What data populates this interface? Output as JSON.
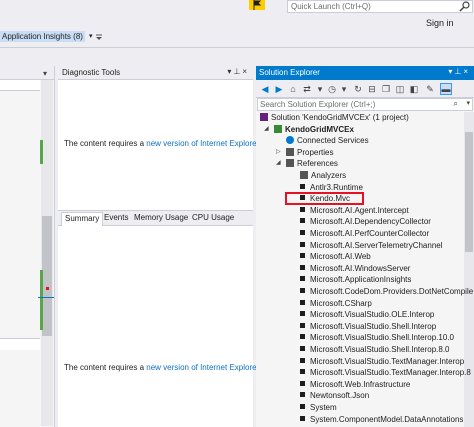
{
  "topbar": {
    "quick_launch_placeholder": "Quick Launch (Ctrl+Q)",
    "sign_in": "Sign in",
    "application_insights": "Application Insights (8)",
    "dropdown_glyph": "▾"
  },
  "diagnostic_tools": {
    "title": "Diagnostic Tools",
    "message_prefix": "The content requires a ",
    "message_link": "new version of Internet Explorer",
    "message_suffix": ".",
    "tabs": [
      "Summary",
      "Events",
      "Memory Usage",
      "CPU Usage"
    ],
    "selected_tab": "Summary"
  },
  "solution_explorer": {
    "title": "Solution Explorer",
    "search_placeholder": "Search Solution Explorer (Ctrl+;)",
    "tree": [
      {
        "label": "Solution 'KendoGridMVCEx' (1 project)",
        "level": 0,
        "icon": "solution-icon"
      },
      {
        "label": "KendoGridMVCEx",
        "level": 1,
        "icon": "project-icon",
        "expanded": true,
        "bold": true
      },
      {
        "label": "Connected Services",
        "level": 2,
        "icon": "connected-services-icon"
      },
      {
        "label": "Properties",
        "level": 2,
        "icon": "wrench-icon",
        "collapsed": true
      },
      {
        "label": "References",
        "level": 2,
        "icon": "references-icon",
        "expanded": true,
        "selected": true
      },
      {
        "label": "Analyzers",
        "level": 3,
        "icon": "analyzer-icon"
      },
      {
        "label": "Antlr3.Runtime",
        "level": 3,
        "icon": "assembly-icon"
      },
      {
        "label": "Kendo.Mvc",
        "level": 3,
        "icon": "assembly-icon",
        "highlighted": true
      },
      {
        "label": "Microsoft.AI.Agent.Intercept",
        "level": 3,
        "icon": "assembly-icon"
      },
      {
        "label": "Microsoft.AI.DependencyCollector",
        "level": 3,
        "icon": "assembly-icon"
      },
      {
        "label": "Microsoft.AI.PerfCounterCollector",
        "level": 3,
        "icon": "assembly-icon"
      },
      {
        "label": "Microsoft.AI.ServerTelemetryChannel",
        "level": 3,
        "icon": "assembly-icon"
      },
      {
        "label": "Microsoft.AI.Web",
        "level": 3,
        "icon": "assembly-icon"
      },
      {
        "label": "Microsoft.AI.WindowsServer",
        "level": 3,
        "icon": "assembly-icon"
      },
      {
        "label": "Microsoft.ApplicationInsights",
        "level": 3,
        "icon": "assembly-icon"
      },
      {
        "label": "Microsoft.CodeDom.Providers.DotNetCompile",
        "level": 3,
        "icon": "assembly-icon"
      },
      {
        "label": "Microsoft.CSharp",
        "level": 3,
        "icon": "assembly-icon"
      },
      {
        "label": "Microsoft.VisualStudio.OLE.Interop",
        "level": 3,
        "icon": "assembly-icon"
      },
      {
        "label": "Microsoft.VisualStudio.Shell.Interop",
        "level": 3,
        "icon": "assembly-icon"
      },
      {
        "label": "Microsoft.VisualStudio.Shell.Interop.10.0",
        "level": 3,
        "icon": "assembly-icon"
      },
      {
        "label": "Microsoft.VisualStudio.Shell.Interop.8.0",
        "level": 3,
        "icon": "assembly-icon"
      },
      {
        "label": "Microsoft.VisualStudio.TextManager.Interop",
        "level": 3,
        "icon": "assembly-icon"
      },
      {
        "label": "Microsoft.VisualStudio.TextManager.Interop.8",
        "level": 3,
        "icon": "assembly-icon"
      },
      {
        "label": "Microsoft.Web.Infrastructure",
        "level": 3,
        "icon": "assembly-icon"
      },
      {
        "label": "Newtonsoft.Json",
        "level": 3,
        "icon": "assembly-icon"
      },
      {
        "label": "System",
        "level": 3,
        "icon": "assembly-icon"
      },
      {
        "label": "System.ComponentModel.DataAnnotations",
        "level": 3,
        "icon": "assembly-icon"
      }
    ]
  },
  "colors": {
    "accent": "#007acc",
    "highlight_box": "#e81123",
    "selection": "#cce8ff",
    "link": "#0e70c0"
  }
}
